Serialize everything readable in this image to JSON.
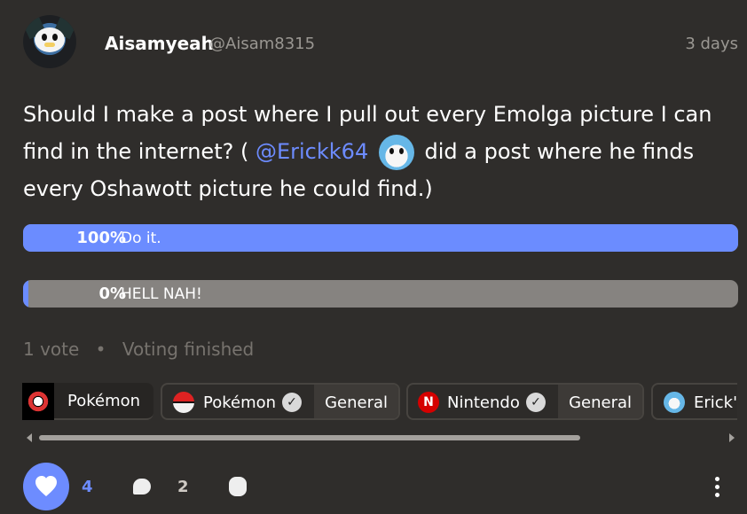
{
  "author": {
    "name": "Aisamyeah",
    "handle": "@Aisam8315",
    "time": "3 days"
  },
  "post": {
    "text_before": "Should I make a post where I pull out every Emolga picture I can find in the internet? (",
    "mention": "@Erickk64",
    "text_after": " did a post where he finds every Oshawott picture he could find.)"
  },
  "poll": {
    "options": [
      {
        "percent": "100%",
        "label": "Do it.",
        "fill": 1.0
      },
      {
        "percent": "0%",
        "label": "HELL NAH!",
        "fill": 0.0
      }
    ],
    "votes": "1 vote",
    "status": "Voting finished"
  },
  "tags": [
    {
      "label": "Pokémon"
    },
    {
      "label": "Pokémon",
      "section": "General"
    },
    {
      "label": "Nintendo",
      "section": "General"
    },
    {
      "label": "Erick's"
    }
  ],
  "actions": {
    "likes": "4",
    "comments": "2"
  },
  "colors": {
    "background": "#2f2d2b",
    "accent": "#6d8cff",
    "muted": "#868380"
  },
  "icons": [
    "avatar",
    "heart-icon",
    "comment-icon",
    "share-icon",
    "more-icon",
    "verified-icon",
    "pokeball-icon",
    "nintendo-icon"
  ]
}
